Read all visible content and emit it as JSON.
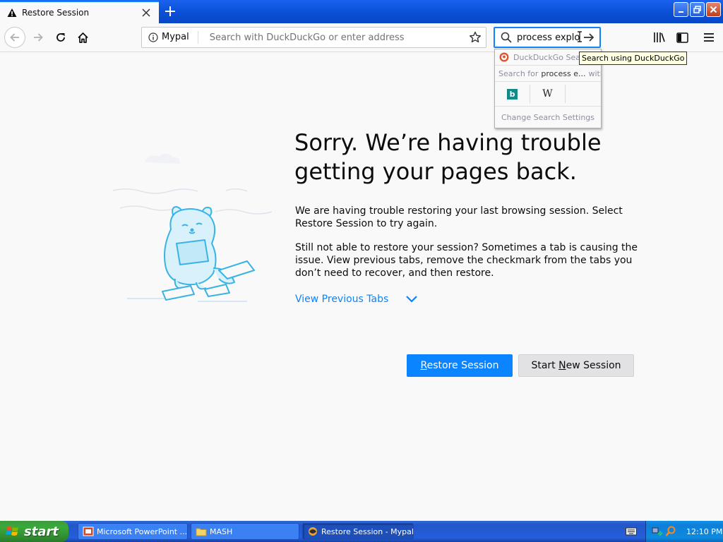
{
  "browser": {
    "tab_title": "Restore Session",
    "new_tab": "+",
    "window_buttons": {
      "minimize": "_",
      "maximize": "❐",
      "close": "✕"
    }
  },
  "toolbar": {
    "site_name": "Mypal",
    "url_placeholder": "Search with DuckDuckGo or enter address",
    "search_value": "process explore"
  },
  "search_popup": {
    "engine_header": "DuckDuckGo Search",
    "search_for_prefix": "Search for",
    "search_for_term": "process e...",
    "search_for_suffix": "with:",
    "engines": [
      "b",
      "W"
    ],
    "settings_label": "Change Search Settings"
  },
  "tooltip": "Search using DuckDuckGo",
  "content": {
    "title": "Sorry. We’re having trouble getting your pages back.",
    "para1": "We are having trouble restoring your last browsing session. Select Restore Session to try again.",
    "para2": "Still not able to restore your session? Sometimes a tab is causing the issue. View previous tabs, remove the checkmark from the tabs you don’t need to recover, and then restore.",
    "view_tabs": "View Previous Tabs",
    "restore_button": "Restore Session",
    "restore_accel": "R",
    "restore_rest": "estore Session",
    "new_button_pre": "Start ",
    "new_button_accel": "N",
    "new_button_rest": "ew Session"
  },
  "taskbar": {
    "start": "start",
    "tasks": [
      "Microsoft PowerPoint ...",
      "MASH",
      "Restore Session - Mypal"
    ],
    "clock": "12:10 PM"
  },
  "colors": {
    "accent": "#0a84ff",
    "xp_blue": "#245edc",
    "xp_green": "#3aa93a"
  }
}
